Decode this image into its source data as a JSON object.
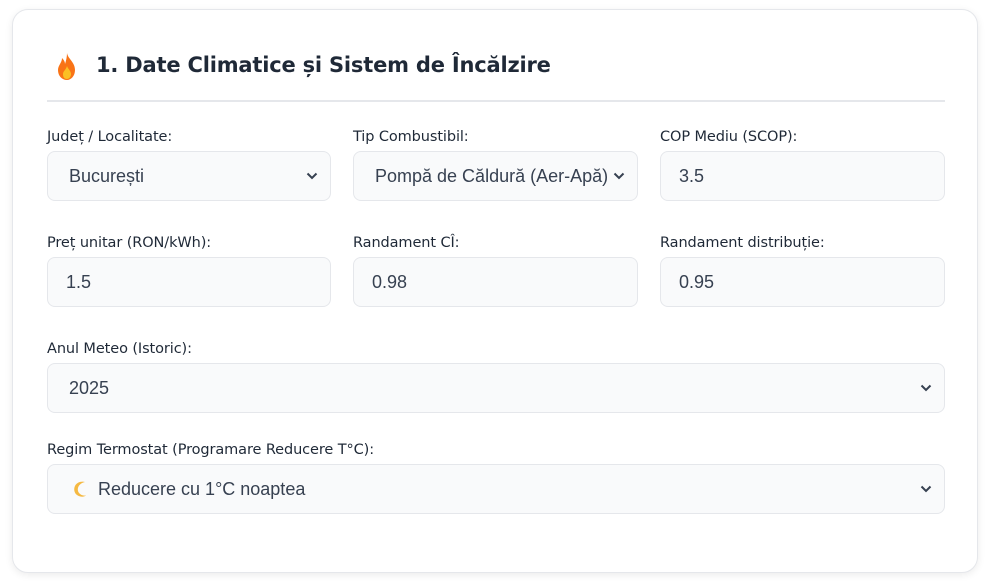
{
  "section": {
    "title": "1. Date Climatice și Sistem de Încălzire",
    "icon": "fire-icon"
  },
  "fields": {
    "county": {
      "label": "Județ / Localitate:",
      "value": "București"
    },
    "fuel": {
      "label": "Tip Combustibil:",
      "value": "Pompă de Căldură (Aer-Apă)"
    },
    "cop": {
      "label": "COP Mediu (SCOP):",
      "value": "3.5"
    },
    "price": {
      "label": "Preț unitar (RON/kWh):",
      "value": "1.5"
    },
    "boiler_eff": {
      "label": "Randament CÎ:",
      "value": "0.98"
    },
    "dist_eff": {
      "label": "Randament distribuție:",
      "value": "0.95"
    },
    "year": {
      "label": "Anul Meteo (Istoric):",
      "value": "2025"
    },
    "thermostat": {
      "label": "Regim Termostat (Programare Reducere T°C):",
      "value": "Reducere cu 1°C noaptea",
      "icon": "crescent-moon-icon"
    }
  },
  "colors": {
    "field_bg": "#f9fafb",
    "field_border": "#e5e7eb",
    "text": "#1f2937",
    "flame_outer": "#f97316",
    "flame_inner": "#fbbf24",
    "moon": "#f5b942"
  }
}
